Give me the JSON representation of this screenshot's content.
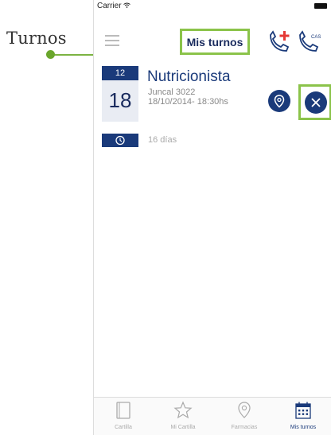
{
  "annotation": {
    "label": "Turnos"
  },
  "status_bar": {
    "carrier": "Carrier"
  },
  "header": {
    "title": "Mis turnos"
  },
  "appointment": {
    "month": "12",
    "day": "18",
    "title": "Nutricionista",
    "address": "Juncal 3022",
    "datetime": "18/10/2014- 18:30hs",
    "remaining": "16 días"
  },
  "tabs": [
    {
      "label": "Cartilla",
      "icon": "book-icon",
      "active": false
    },
    {
      "label": "Mi Cartilla",
      "icon": "star-icon",
      "active": false
    },
    {
      "label": "Farmacias",
      "icon": "location-icon",
      "active": false
    },
    {
      "label": "Mis turnos",
      "icon": "calendar-icon",
      "active": true
    }
  ],
  "colors": {
    "accent": "#1a3a7a",
    "highlight": "#8bc34a",
    "emergency": "#e53935"
  }
}
